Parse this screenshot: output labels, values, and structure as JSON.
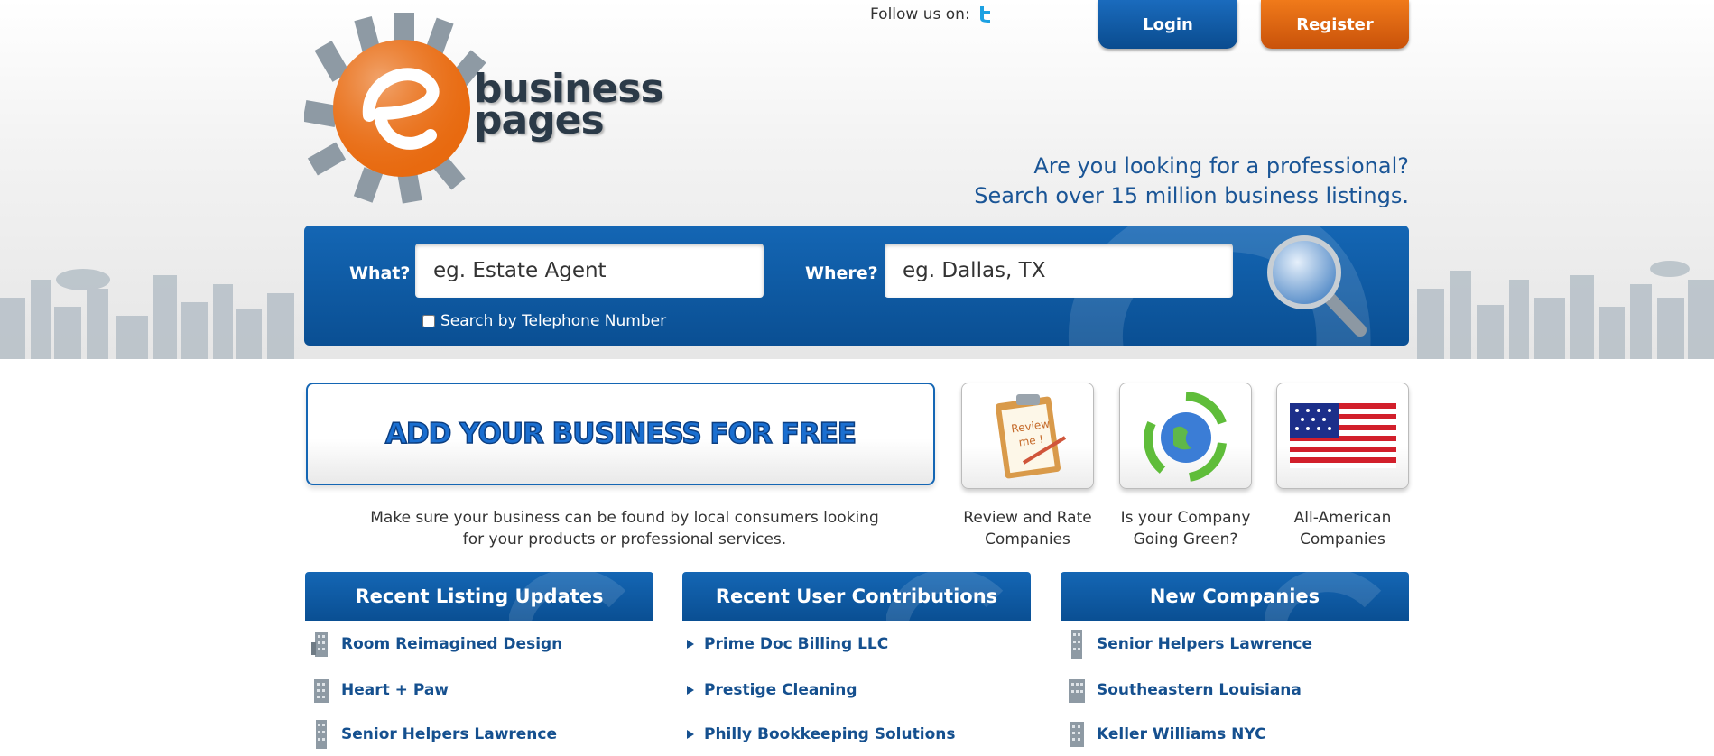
{
  "header": {
    "logo_word_1": "business",
    "logo_word_2": "pages",
    "follow_label": "Follow us on:",
    "login_label": "Login",
    "register_label": "Register",
    "tagline_line1": "Are you looking for a professional?",
    "tagline_line2": "Search over 15 million business listings."
  },
  "search": {
    "what_label": "What?",
    "what_placeholder": "eg. Estate Agent",
    "where_label": "Where?",
    "where_placeholder": "eg. Dallas, TX",
    "telephone_label": "Search by Telephone Number"
  },
  "promo": {
    "add_business_label": "ADD YOUR BUSINESS FOR FREE",
    "add_business_desc": "Make sure your business can be found by local consumers looking for your products or professional services.",
    "items": [
      {
        "label": "Review and Rate Companies"
      },
      {
        "label": "Is your Company Going Green?"
      },
      {
        "label": "All-American Companies"
      }
    ]
  },
  "columns": [
    {
      "title": "Recent Listing Updates",
      "items": [
        "Room Reimagined Design",
        "Heart + Paw",
        "Senior Helpers Lawrence"
      ]
    },
    {
      "title": "Recent User Contributions",
      "items": [
        "Prime Doc Billing LLC",
        "Prestige Cleaning",
        "Philly Bookkeeping Solutions"
      ]
    },
    {
      "title": "New Companies",
      "items": [
        "Senior Helpers Lawrence",
        "Southeastern Louisiana",
        "Keller Williams NYC"
      ]
    }
  ],
  "colors": {
    "brand_blue": "#0a4f93",
    "accent_orange": "#e8690e",
    "link_blue": "#15508f"
  },
  "icons": {
    "twitter": "twitter-icon",
    "search": "magnifier-icon",
    "listing": "building-icon",
    "contribution": "arrow-right-icon"
  }
}
